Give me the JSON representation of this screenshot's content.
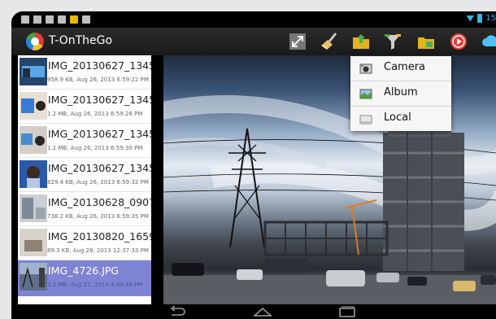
{
  "status": {
    "time": "15"
  },
  "app": {
    "title": "T-OnTheGo"
  },
  "toolbar": [
    "fullscreen-icon",
    "broom-icon",
    "folder-upload-icon",
    "filter-icon",
    "folder-export-icon",
    "record-icon",
    "cloud-icon"
  ],
  "files": [
    {
      "name": "IMG_20130627_1345...",
      "meta": "958.9 KB, Aug 26, 2013 6:59:22 PM"
    },
    {
      "name": "IMG_20130627_1345...",
      "meta": "1.2 MB, Aug 26, 2013 6:59:26 PM"
    },
    {
      "name": "IMG_20130627_1345...",
      "meta": "1.2 MB, Aug 26, 2013 6:59:30 PM"
    },
    {
      "name": "IMG_20130627_1345...",
      "meta": "829.4 KB, Aug 26, 2013 6:59:32 PM"
    },
    {
      "name": "IMG_20130628_0907...",
      "meta": "738.2 KB, Aug 26, 2013 6:59:35 PM"
    },
    {
      "name": "IMG_20130820_1659...",
      "meta": "89.3 KB, Aug 28, 2013 12:37:33 PM"
    },
    {
      "name": "IMG_4726.JPG",
      "meta": "3.2 MB, Aug 27, 2013 4:34:38 PM",
      "selected": true
    }
  ],
  "menu": [
    {
      "label": "Camera",
      "icon": "camera-icon"
    },
    {
      "label": "Album",
      "icon": "album-icon"
    },
    {
      "label": "Local",
      "icon": "drive-icon"
    }
  ],
  "colors": {
    "selection": "#7f83d4",
    "accent": "#33b5e5"
  }
}
